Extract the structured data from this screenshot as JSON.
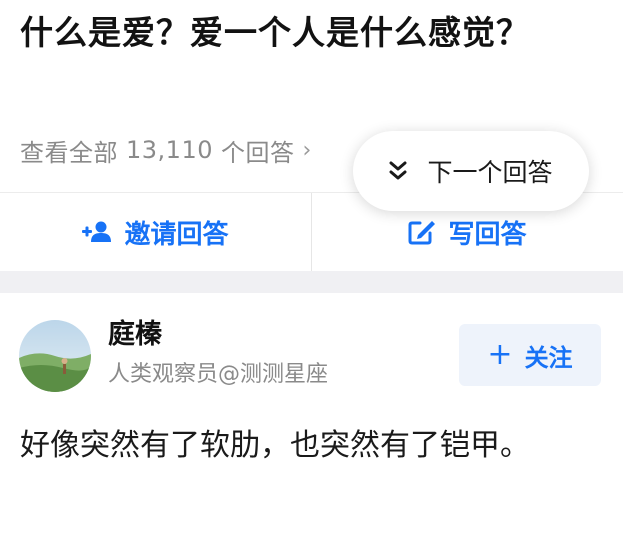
{
  "question": {
    "title": "什么是爱？爱一个人是什么感觉？"
  },
  "view_all": {
    "prefix": "查看全部",
    "count": "13,110",
    "suffix": "个回答",
    "chevron": "›"
  },
  "next_answer": {
    "icon": "double-chevron-down-icon",
    "label": "下一个回答"
  },
  "actions": {
    "invite": {
      "icon": "add-user-icon",
      "label": "邀请回答"
    },
    "write": {
      "icon": "edit-icon",
      "label": "写回答"
    }
  },
  "author": {
    "name": "庭榛",
    "bio": "人类观察员@测测星座",
    "follow_label": "关注"
  },
  "answer": {
    "text": "好像突然有了软肋，也突然有了铠甲。"
  },
  "colors": {
    "accent": "#1772f6",
    "muted": "#8a8a8a",
    "follow_bg": "#eef3fb",
    "separator": "#f0f0f3"
  }
}
